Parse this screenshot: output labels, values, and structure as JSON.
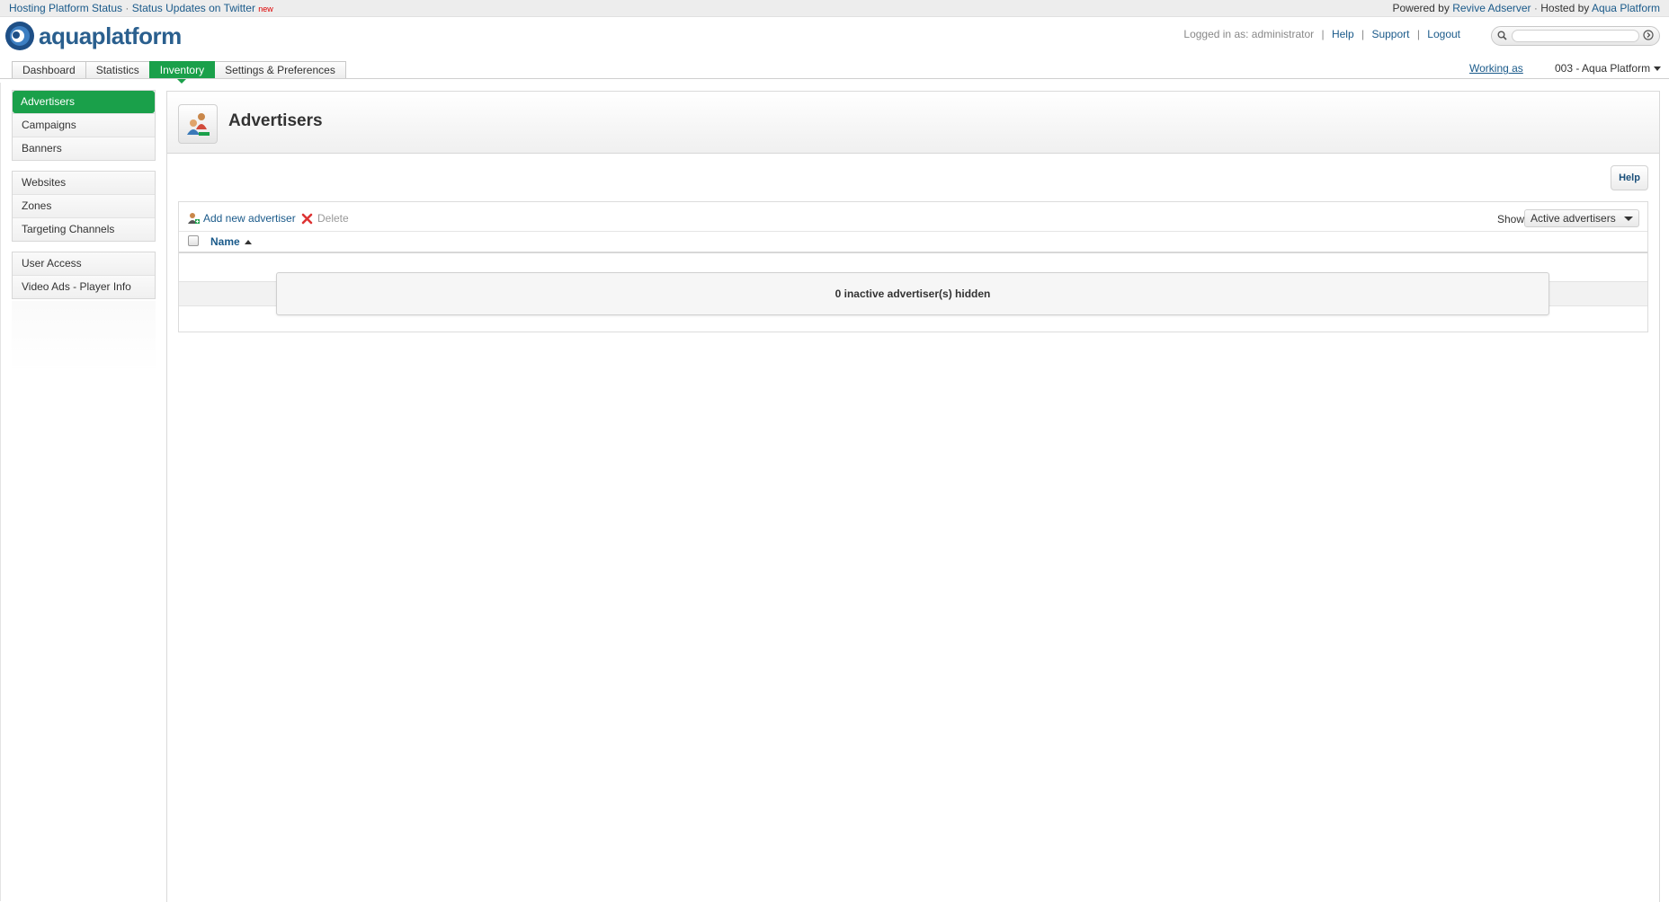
{
  "topbar": {
    "platform_status": "Hosting Platform Status",
    "separator": "·",
    "twitter": "Status Updates on Twitter",
    "new_badge": "new",
    "powered_by": "Powered by",
    "revive": "Revive Adserver",
    "hosted_by": "Hosted by",
    "aqua": "Aqua Platform"
  },
  "logo": {
    "text": "aquaplatform",
    "icon": "aquaplatform-logo-icon"
  },
  "user": {
    "logged_in": "Logged in as: administrator",
    "help": "Help",
    "support": "Support",
    "logout": "Logout",
    "divider": "|"
  },
  "search": {
    "placeholder": "",
    "icon": "search-icon",
    "go_icon": "go-icon"
  },
  "tabs": [
    {
      "label": "Dashboard"
    },
    {
      "label": "Statistics"
    },
    {
      "label": "Inventory",
      "active": true
    },
    {
      "label": "Settings & Preferences"
    }
  ],
  "working_as": {
    "label": "Working as",
    "account": "003 - Aqua Platform"
  },
  "sidebar": {
    "group1": [
      {
        "label": "Advertisers",
        "active": true
      },
      {
        "label": "Campaigns"
      },
      {
        "label": "Banners"
      }
    ],
    "group2": [
      {
        "label": "Websites"
      },
      {
        "label": "Zones"
      },
      {
        "label": "Targeting Channels"
      }
    ],
    "group3": [
      {
        "label": "User Access"
      },
      {
        "label": "Video Ads - Player Info"
      }
    ]
  },
  "page": {
    "title": "Advertisers",
    "icon": "advertisers-icon",
    "help_button": "Help"
  },
  "toolbar": {
    "add_label": "Add new advertiser",
    "delete_label": "Delete",
    "show_label": "Show",
    "filter_value": "Active advertisers"
  },
  "table": {
    "name_header": "Name",
    "hidden_message": "0 inactive advertiser(s) hidden"
  },
  "colors": {
    "accent": "#1aa04a",
    "link": "#1a5a8a",
    "delete": "#d33"
  }
}
